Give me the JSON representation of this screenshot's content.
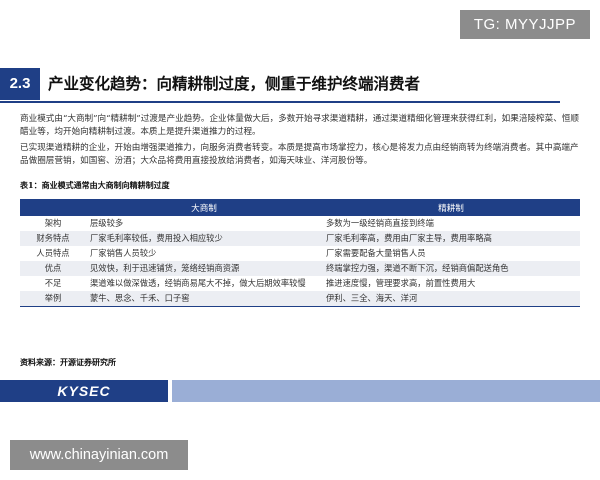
{
  "watermark_top": "TG: MYYJJPP",
  "section": {
    "number": "2.3",
    "title": "产业变化趋势：向精耕制过度，侧重于维护终端消费者"
  },
  "paragraphs": [
    "商业模式由“大商制”向“精耕制”过渡是产业趋势。企业体量做大后，多数开始寻求渠道精耕，通过渠道精细化管理来获得红利，如果涪陵榨菜、恒顺醋业等，均开始向精耕制过渡。本质上是提升渠道推力的过程。",
    "已实现渠道精耕的企业，开始由增强渠道推力，向服务消费者转变。本质是提高市场掌控力，核心是将发力点由经销商转为终端消费者。其中高端产品做圈层营销，如国窖、汾酒；大众品将费用直接投放给消费者，如海天味业、洋河股份等。"
  ],
  "table": {
    "title": "表1：商业模式通常由大商制向精耕制过度",
    "headers": [
      "",
      "大商制",
      "精耕制"
    ],
    "rows": [
      {
        "label": "架构",
        "a": "层级较多",
        "b": "多数为一级经销商直接到终端"
      },
      {
        "label": "财务特点",
        "a": "厂家毛利率较低，费用投入相应较少",
        "b": "厂家毛利率高，费用由厂家主导，费用率略高"
      },
      {
        "label": "人员特点",
        "a": "厂家销售人员较少",
        "b": "厂家需要配备大量销售人员"
      },
      {
        "label": "优点",
        "a": "见效快，利于迅速铺货，笼络经销商资源",
        "b": "终端掌控力强，渠道不断下沉，经销商偏配送角色"
      },
      {
        "label": "不足",
        "a": "渠道难以做深做透，经销商易尾大不掉，做大后期效率较慢",
        "b": "推进速度慢，管理要求高，前置性费用大"
      },
      {
        "label": "举例",
        "a": "蒙牛、思念、千禾、口子窖",
        "b": "伊利、三全、海天、洋河"
      }
    ]
  },
  "source": "资料来源：开源证券研究所",
  "logo": "KYSEC",
  "watermark_bottom": "www.chinayinian.com",
  "colors": {
    "brand_blue": "#1f3f86",
    "footer_light_blue": "#9aaed6",
    "watermark_gray": "#8c8c8c",
    "row_alt": "#eceef3"
  }
}
